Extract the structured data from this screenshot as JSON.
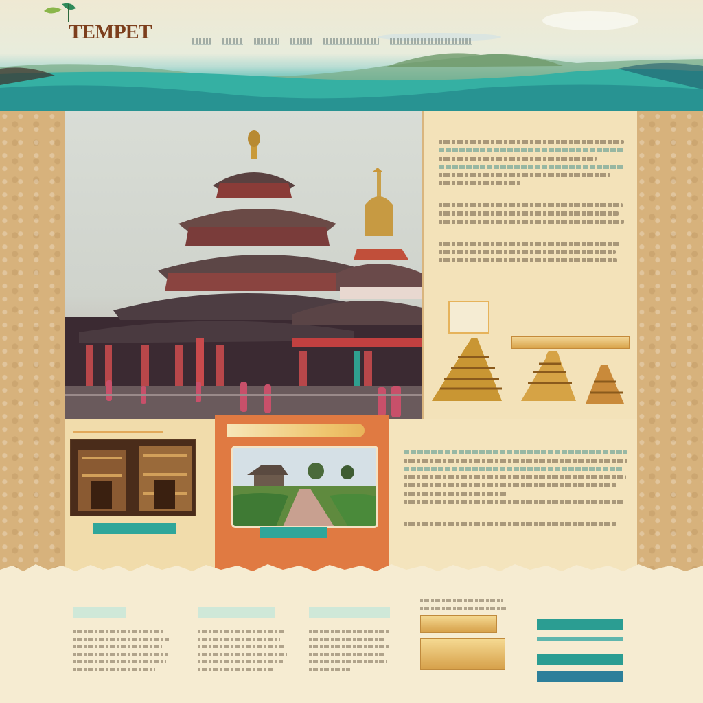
{
  "header": {
    "brand": "TEMPET",
    "tagline": "",
    "nav_items": [
      "",
      "",
      "",
      "",
      "",
      ""
    ]
  },
  "info_panel": {
    "title": "",
    "button_label": ""
  },
  "cards": {
    "left_caption": "",
    "left_button": "",
    "middle_title": "",
    "middle_button": "",
    "right_title": ""
  },
  "footer": {
    "columns": [
      {
        "title": "",
        "subtitle": ""
      },
      {
        "title": "",
        "subtitle": ""
      },
      {
        "title": "",
        "subtitle": ""
      }
    ],
    "deal_title": "",
    "deal_label": "",
    "deal_label_2": "",
    "buttons_title": "",
    "buttons": [
      "",
      "",
      "",
      ""
    ]
  },
  "icons": [
    "leaf-icon",
    "temple-icon"
  ],
  "colors": {
    "teal": "#2fa69a",
    "terracotta": "#e07a42",
    "sand": "#d7b27c",
    "gold": "#d9a44c",
    "brand_brown": "#7c3e1c"
  }
}
